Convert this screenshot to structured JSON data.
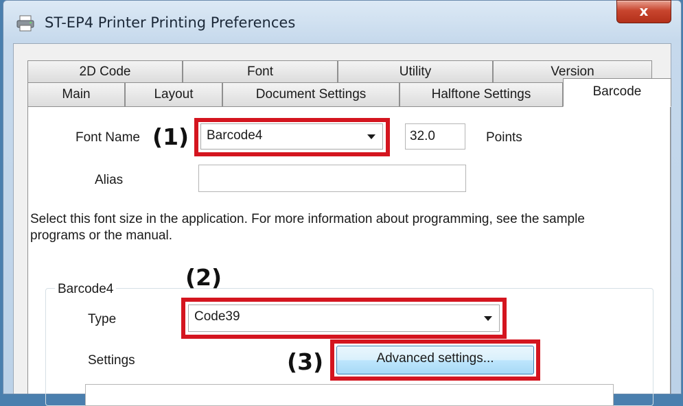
{
  "window": {
    "title": "ST-EP4 Printer Printing Preferences",
    "close_label": "x"
  },
  "tabs": {
    "row1": [
      "2D Code",
      "Font",
      "Utility",
      "Version"
    ],
    "row2": [
      "Main",
      "Layout",
      "Document Settings",
      "Halftone Settings",
      "Barcode"
    ],
    "active": "Barcode"
  },
  "form": {
    "font_name_label": "Font Name",
    "font_name_value": "Barcode4",
    "size_value": "32.0",
    "size_unit": "Points",
    "alias_label": "Alias",
    "alias_value": "",
    "description": "Select this font size in the application. For more information about programming, see the sample programs or the manual."
  },
  "group": {
    "title": "Barcode4",
    "type_label": "Type",
    "type_value": "Code39",
    "settings_label": "Settings",
    "advanced_button": "Advanced settings..."
  },
  "annotations": {
    "a1": "(1)",
    "a2": "(2)",
    "a3": "(3)",
    "color": "#d4151f"
  }
}
